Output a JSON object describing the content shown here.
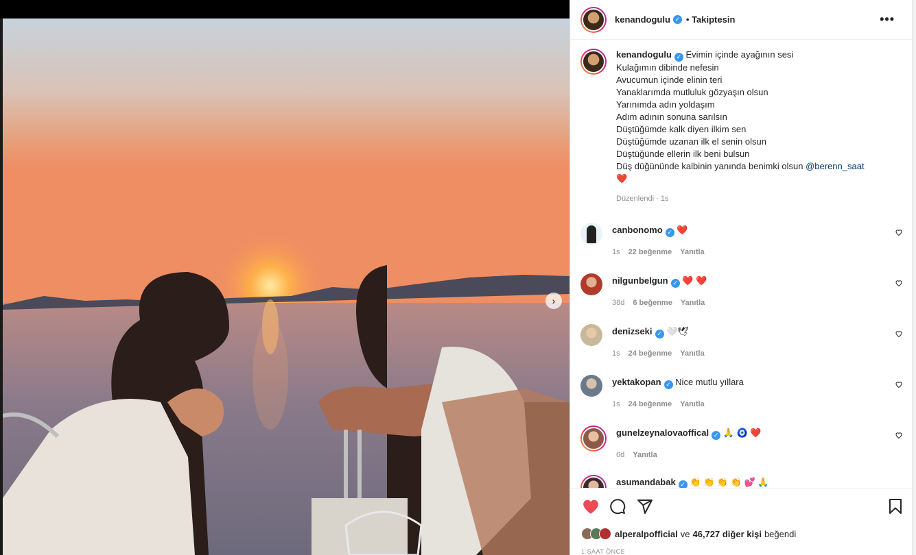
{
  "post": {
    "author": "kenandogulu",
    "follow_state": "Takiptesin",
    "more_icon": "•••",
    "caption_lines": [
      "Evimin içinde ayağının sesi",
      "Kulağımın dibinde nefesin",
      "Avucumun içinde elinin teri",
      "Yanaklarımda mutluluk gözyaşın olsun",
      "Yarınımda adın yoldaşım",
      "Adım adının sonuna sarılsın",
      "Düştüğümde kalk diyen ilkim sen",
      "Düştüğümde uzanan ilk el senin olsun",
      "Düştüğünde ellerin ilk beni bulsun",
      "Düş düğününde kalbinin yanında benimki olsun"
    ],
    "caption_mention": "@berenn_saat",
    "caption_emoji": "❤️",
    "caption_meta": "Düzenlendi · 1s"
  },
  "comments": [
    {
      "user": "canbonomo",
      "text": "❤️",
      "time": "1s",
      "likes": "22 beğenme",
      "reply": "Yanıtla",
      "avatar_color": "#2b2b2b"
    },
    {
      "user": "nilgunbelgun",
      "text": "❤️ ❤️",
      "time": "38d",
      "likes": "6 beğenme",
      "reply": "Yanıtla",
      "avatar_color": "#b23a2a"
    },
    {
      "user": "denizseki",
      "text": "🤍🕊",
      "time": "1s",
      "likes": "24 beğenme",
      "reply": "Yanıtla",
      "avatar_color": "#c9b79a"
    },
    {
      "user": "yektakopan",
      "text": "Nice mutlu yıllara",
      "time": "1s",
      "likes": "24 beğenme",
      "reply": "Yanıtla",
      "avatar_color": "#6b7a8a"
    },
    {
      "user": "gunelzeynalovaoffical",
      "text": "🙏 🧿 ❤️",
      "time": "6d",
      "likes": "",
      "reply": "Yanıtla",
      "avatar_color": "#8a5a4a"
    },
    {
      "user": "asumandabak",
      "text": "👏 👏 👏 👏 💕 🙏",
      "time": "",
      "likes": "",
      "reply": "",
      "avatar_color": "#3a2a2a"
    }
  ],
  "actions": {
    "like_icon": "heart-filled",
    "comment_icon": "comment",
    "share_icon": "paper-plane",
    "save_icon": "bookmark",
    "liked_by_user": "alperalpofficial",
    "liked_by_connector": "ve",
    "liked_by_count": "46,727 diğer kişi",
    "liked_by_suffix": "beğendi",
    "timestamp": "1 SAAT ÖNCE"
  },
  "colors": {
    "accent_red": "#ed4956",
    "link_blue": "#00376b",
    "verified_blue": "#3897f0"
  }
}
